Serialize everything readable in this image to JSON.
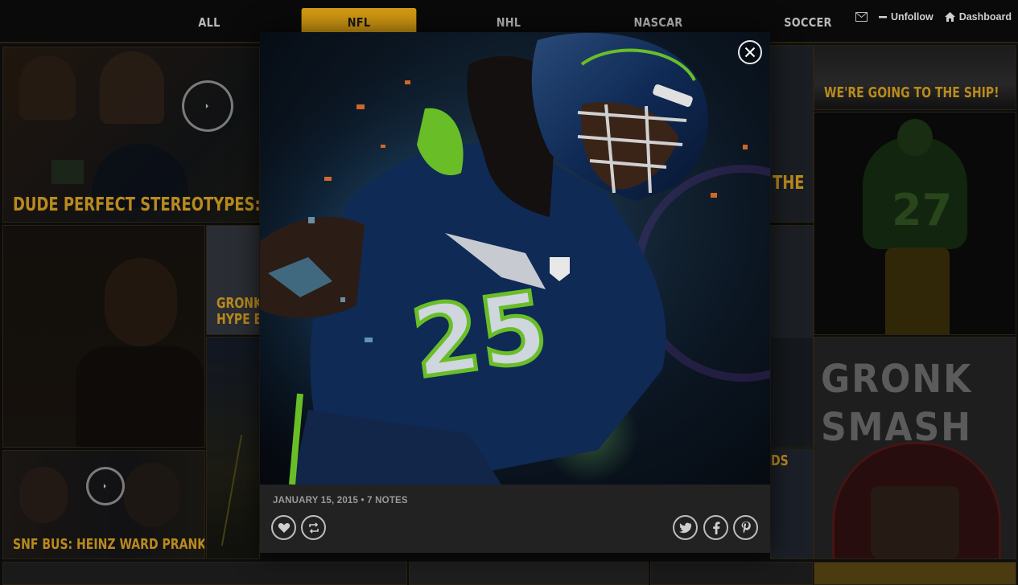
{
  "nav": {
    "tabs": [
      {
        "label": "ALL",
        "active": false
      },
      {
        "label": "NFL",
        "active": true
      },
      {
        "label": "NHL",
        "active": false
      },
      {
        "label": "NASCAR",
        "active": false
      },
      {
        "label": "SOCCER",
        "active": false
      }
    ],
    "mail_icon": "mail-icon",
    "unfollow_label": "Unfollow",
    "dashboard_label": "Dashboard"
  },
  "grid": {
    "tiles": [
      {
        "caption": "DUDE PERFECT STEREOTYPES: SUPER",
        "has_play": true
      },
      {
        "caption": "WE'RE GOING TO THE SHIP!",
        "has_play": false
      },
      {
        "caption": "THE",
        "has_play": false
      },
      {
        "caption": "GRONK P",
        "has_play": false
      },
      {
        "caption": "HYPE BR",
        "has_play": false
      },
      {
        "caption": "SNF BUS: HEINZ WARD PRANK",
        "has_play": true
      },
      {
        "caption": "DS",
        "has_play": false
      },
      {
        "caption": "GRONK",
        "has_play": false
      },
      {
        "caption": "SMASH",
        "has_play": false
      }
    ]
  },
  "post": {
    "date": "JANUARY 15, 2015",
    "separator": "•",
    "notes": "7 NOTES",
    "actions": [
      "like-icon",
      "reblog-icon"
    ],
    "share": [
      "twitter-icon",
      "facebook-icon",
      "pinterest-icon"
    ],
    "close_icon": "close-icon",
    "image": "football-player-photo",
    "jersey_number": "25"
  },
  "colors": {
    "accent": "#d39a12",
    "caption": "#b98a1d",
    "lightbox_footer": "#222222",
    "seahawks_navy": "#0f2a55",
    "action_green": "#69be28"
  }
}
